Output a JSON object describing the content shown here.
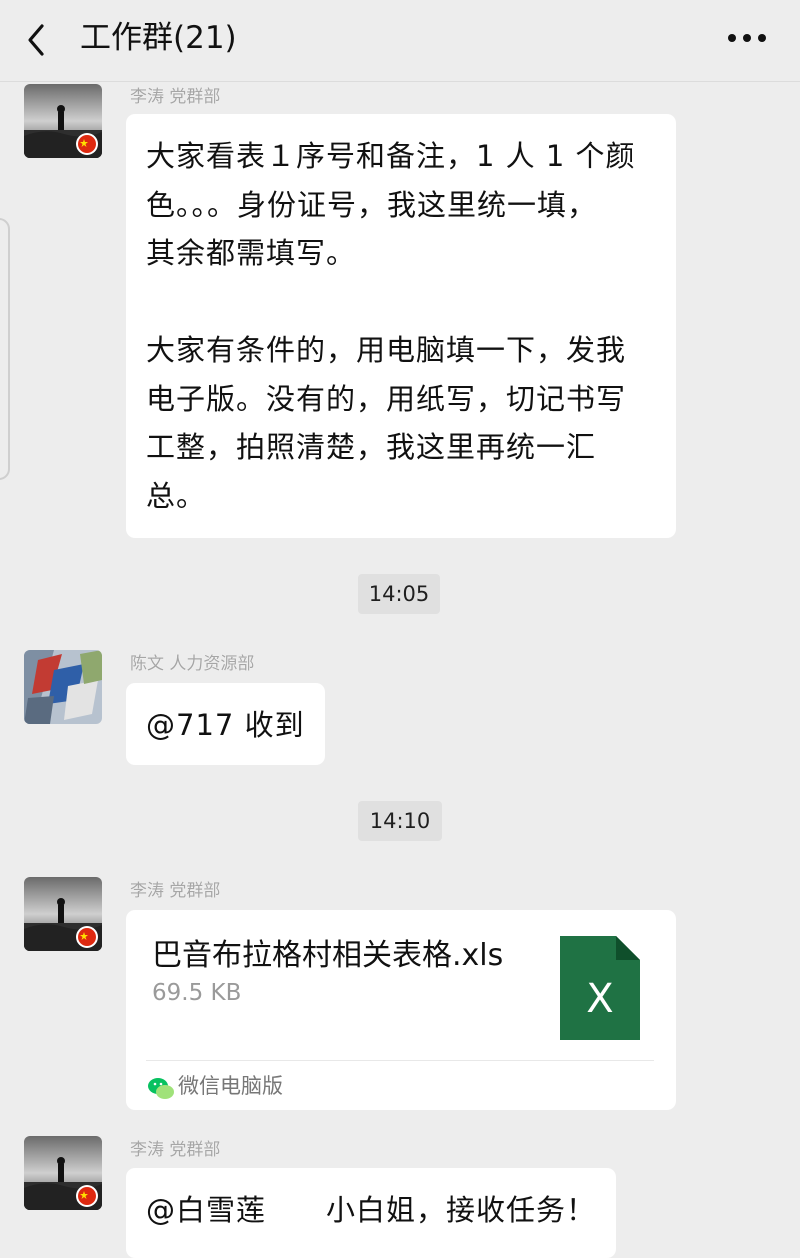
{
  "header": {
    "title": "工作群(21)",
    "back_icon": "chevron-left-icon",
    "more_icon": "more-dots-icon"
  },
  "messages": [
    {
      "sender": "李涛 党群部",
      "lines": [
        "大家看表１序号和备注，1 人 1 个颜",
        "色。。。身份证号，我这里统一填，",
        "其余都需填写。",
        "",
        "大家有条件的，用电脑填一下，发我",
        "电子版。没有的，用纸写，切记书写",
        "工整，拍照清楚，我这里再统一汇",
        "总。"
      ]
    },
    {
      "time": "14:05"
    },
    {
      "sender": "陈文 人力资源部",
      "text": "@717  收到"
    },
    {
      "time": "14:10"
    },
    {
      "sender": "李涛 党群部",
      "file": {
        "name": "巴音布拉格村相关表格.xls",
        "size": "69.5 KB",
        "icon": "excel-file-icon",
        "icon_letter": "X",
        "source": "微信电脑版",
        "source_icon": "wechat-icon"
      }
    },
    {
      "sender": "李涛 党群部",
      "text": "@白雪莲　　小白姐，接收任务！"
    }
  ],
  "colors": {
    "background": "#ededed",
    "bubble": "#ffffff",
    "excel_green": "#1f7244",
    "wechat_green": "#07c160"
  }
}
